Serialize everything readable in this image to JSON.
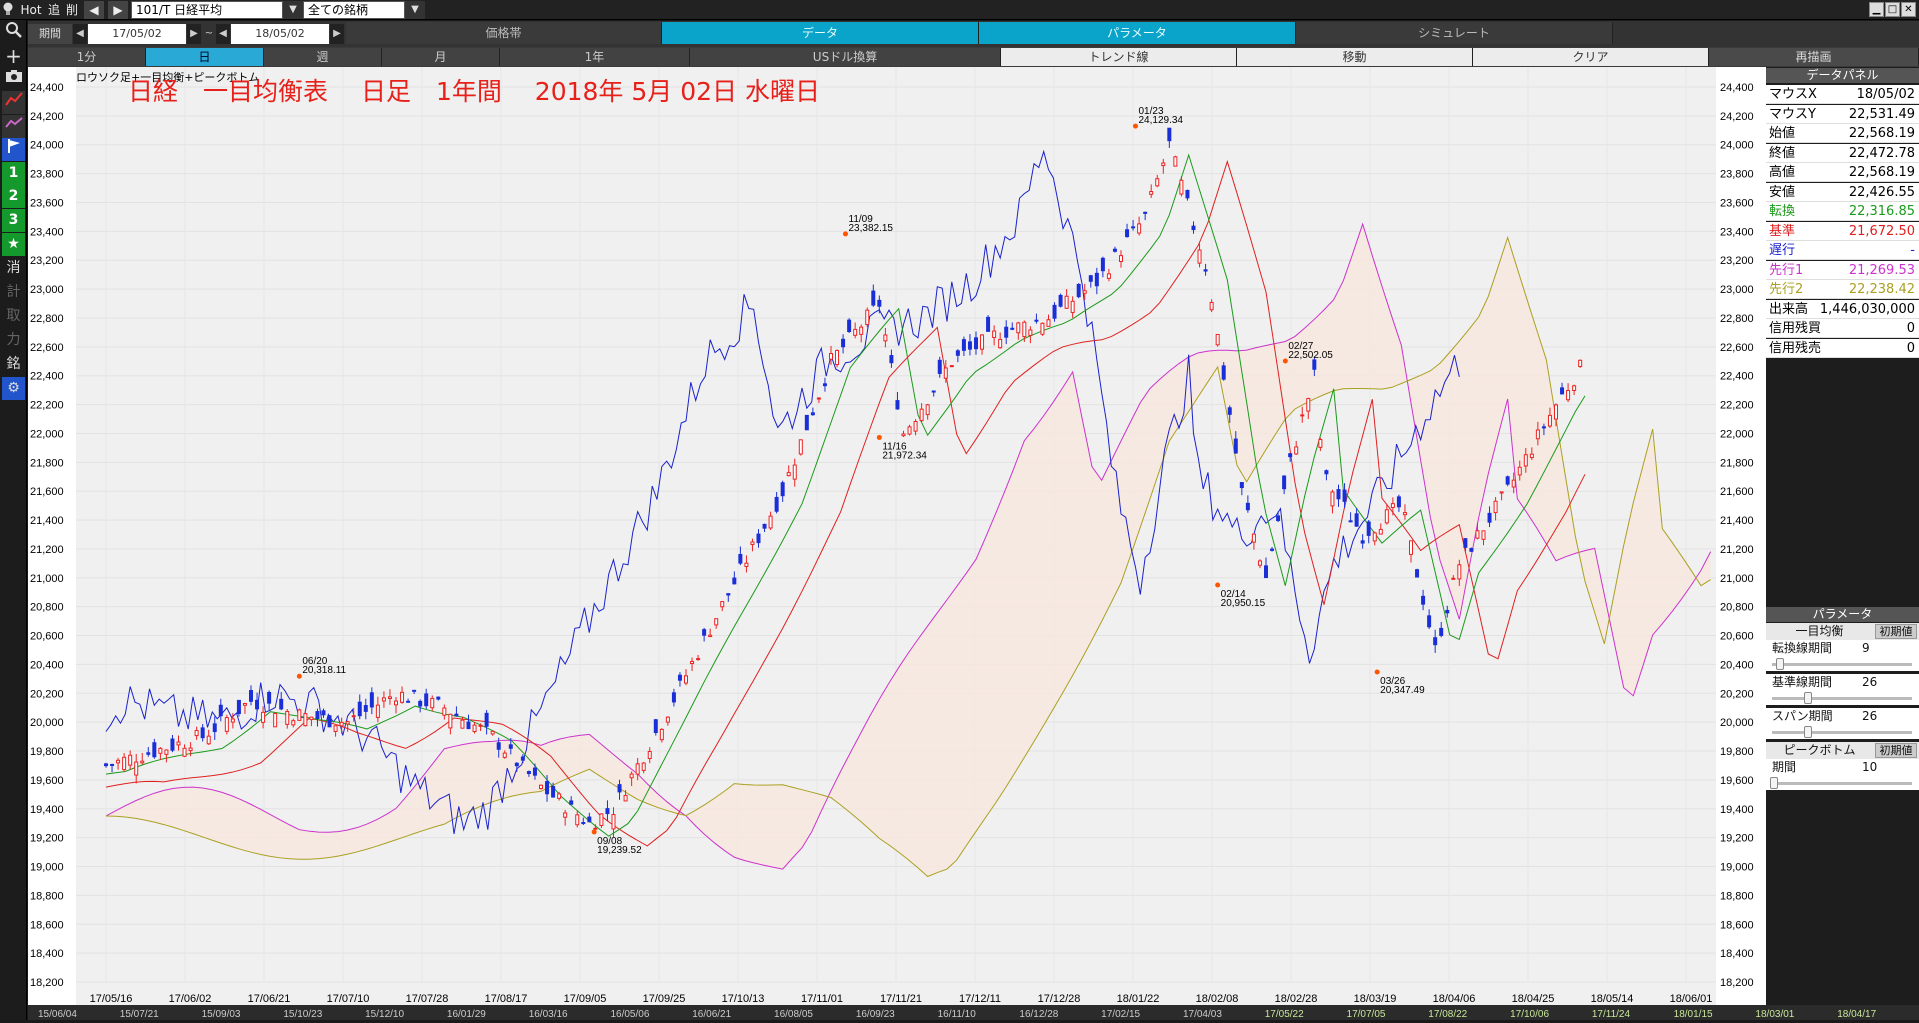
{
  "topbar": {
    "hot_label": "Hot",
    "tsui_label": "追",
    "sakujo_label": "削",
    "symbol": "101/T 日経平均",
    "universe": "全ての銘柄"
  },
  "period_bar": {
    "label": "期間",
    "from": "17/05/02",
    "tilde": "~",
    "to": "18/05/02",
    "tabs": [
      "価格帯",
      "データ",
      "パラメータ",
      "シミュレート"
    ],
    "active_tab": "データ"
  },
  "period_tabs": [
    "1分",
    "日",
    "週",
    "月",
    "1年",
    "USドル換算"
  ],
  "active_period": "日",
  "right_tabs": [
    "トレンド線",
    "移動",
    "クリア",
    "再描画"
  ],
  "chart": {
    "mode_label": "ロウソク足+一目均衡+ピークボトム",
    "title": "日経　一目均衡表　 日足　1年間　 2018年 5月 02日 水曜日",
    "y_ticks": [
      "24,400",
      "24,200",
      "24,000",
      "23,800",
      "23,600",
      "23,400",
      "23,200",
      "23,000",
      "22,800",
      "22,600",
      "22,400",
      "22,200",
      "22,000",
      "21,800",
      "21,600",
      "21,400",
      "21,200",
      "21,000",
      "20,800",
      "20,600",
      "20,400",
      "20,200",
      "20,000",
      "19,800",
      "19,600",
      "19,400",
      "19,200",
      "19,000",
      "18,800",
      "18,600",
      "18,400",
      "18,200"
    ],
    "x_ticks": [
      "17/05/16",
      "17/06/02",
      "17/06/21",
      "17/07/10",
      "17/07/28",
      "17/08/17",
      "17/09/05",
      "17/09/25",
      "17/10/13",
      "17/11/01",
      "17/11/21",
      "17/12/11",
      "17/12/28",
      "18/01/22",
      "18/02/08",
      "18/02/28",
      "18/03/19",
      "18/04/06",
      "18/04/25",
      "18/05/14",
      "18/06/01"
    ],
    "bottom_ticks": [
      "15/06/04",
      "15/07/21",
      "15/09/03",
      "15/10/23",
      "15/12/10",
      "16/01/29",
      "16/03/16",
      "16/05/06",
      "16/06/21",
      "16/08/05",
      "16/09/23",
      "16/11/10",
      "16/12/28",
      "17/02/15",
      "17/04/03",
      "17/05/22",
      "17/07/05",
      "17/08/22",
      "17/10/06",
      "17/11/24",
      "18/01/15",
      "18/03/01",
      "18/04/17"
    ],
    "colors": {
      "up": "#ee2222",
      "down": "#1a2fd8",
      "tenkan": "#1a9a1a",
      "kijun": "#e02020",
      "chikou": "#1a22cc",
      "senkou1": "#cc33cc",
      "senkou2": "#aaa022",
      "peak": "#ff5500"
    },
    "peaks": [
      {
        "date": "06/20",
        "value": "20,318.11"
      },
      {
        "date": "09/08",
        "value": "19,239.52"
      },
      {
        "date": "11/09",
        "value": "23,382.15"
      },
      {
        "date": "11/16",
        "value": "21,972.34"
      },
      {
        "date": "01/23",
        "value": "24,129.34"
      },
      {
        "date": "02/14",
        "value": "20,950.15"
      },
      {
        "date": "02/27",
        "value": "22,502.05"
      },
      {
        "date": "03/26",
        "value": "20,347.49"
      }
    ]
  },
  "data_panel": {
    "title": "データパネル",
    "rows": [
      {
        "k": "マウスX",
        "v": "18/05/02",
        "color": "#000000"
      },
      {
        "k": "マウスY",
        "v": "22,531.49",
        "color": "#000000"
      },
      {
        "k": "始値",
        "v": "22,568.19",
        "color": "#000000"
      },
      {
        "k": "終値",
        "v": "22,472.78",
        "color": "#000000"
      },
      {
        "k": "高値",
        "v": "22,568.19",
        "color": "#000000"
      },
      {
        "k": "安値",
        "v": "22,426.55",
        "color": "#000000"
      },
      {
        "k": "転換",
        "v": "22,316.85",
        "color": "#1a9a1a"
      },
      {
        "k": "基準",
        "v": "21,672.50",
        "color": "#e02020"
      },
      {
        "k": "遅行",
        "v": "-",
        "color": "#1a22cc"
      },
      {
        "k": "先行1",
        "v": "21,269.53",
        "color": "#cc33cc"
      },
      {
        "k": "先行2",
        "v": "22,238.42",
        "color": "#aaa022"
      },
      {
        "k": "出来高",
        "v": "1,446,030,000",
        "color": "#000000"
      },
      {
        "k": "信用残買",
        "v": "0",
        "color": "#000000"
      },
      {
        "k": "信用残売",
        "v": "0",
        "color": "#000000"
      }
    ]
  },
  "param_panel": {
    "title": "パラメータ",
    "ichimoku_label": "一目均衡",
    "reset_label": "初期値",
    "tenkan_label": "転換線期間",
    "tenkan_value": "9",
    "kijun_label": "基準線期間",
    "kijun_value": "26",
    "span_label": "スパン期間",
    "span_value": "26",
    "pb_label": "ピークボトム",
    "pb_reset_label": "初期値",
    "period_label": "期間",
    "period_value": "10"
  }
}
